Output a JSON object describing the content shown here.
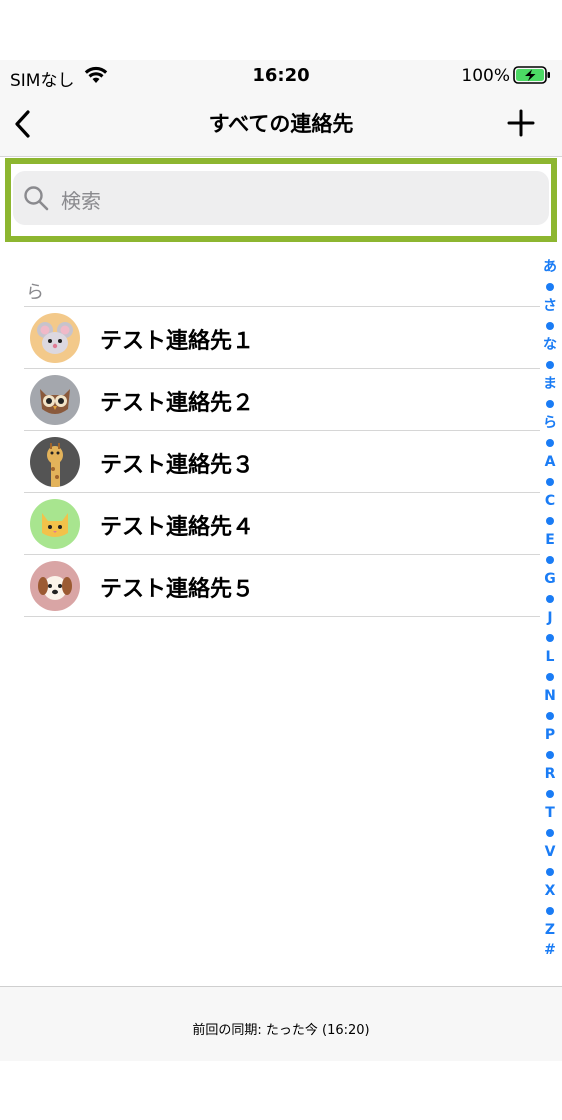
{
  "status_bar": {
    "carrier": "SIMなし",
    "time": "16:20",
    "battery_percent": "100%",
    "battery_level": 1.0,
    "battery_charging": true,
    "battery_color": "#4cd964"
  },
  "nav": {
    "title": "すべての連絡先",
    "back_icon": "chevron-left-icon",
    "add_icon": "plus-icon"
  },
  "search": {
    "placeholder": "検索",
    "highlight_color": "#8db630"
  },
  "section": {
    "header": "ら"
  },
  "contacts": [
    {
      "name": "テスト連絡先１",
      "avatar": "mouse-avatar",
      "avatar_bg": "#f3c98a"
    },
    {
      "name": "テスト連絡先２",
      "avatar": "owl-avatar",
      "avatar_bg": "#a4a7ad"
    },
    {
      "name": "テスト連絡先３",
      "avatar": "giraffe-avatar",
      "avatar_bg": "#545454"
    },
    {
      "name": "テスト連絡先４",
      "avatar": "cat-avatar",
      "avatar_bg": "#a8e58f"
    },
    {
      "name": "テスト連絡先５",
      "avatar": "dog-avatar",
      "avatar_bg": "#d9a5a5"
    }
  ],
  "index": [
    "あ",
    "•",
    "さ",
    "•",
    "な",
    "•",
    "ま",
    "•",
    "ら",
    "•",
    "A",
    "•",
    "C",
    "•",
    "E",
    "•",
    "G",
    "•",
    "J",
    "•",
    "L",
    "•",
    "N",
    "•",
    "P",
    "•",
    "R",
    "•",
    "T",
    "•",
    "V",
    "•",
    "X",
    "•",
    "Z",
    "#"
  ],
  "footer": {
    "sync_text": "前回の同期: たった今 (16:20)"
  },
  "colors": {
    "accent": "#1a7cf5"
  }
}
